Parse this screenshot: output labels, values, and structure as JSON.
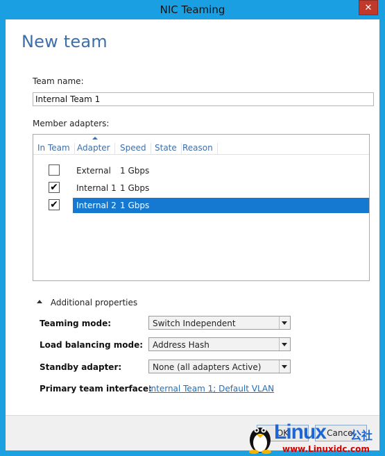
{
  "window": {
    "title": "NIC Teaming",
    "close_glyph": "✕"
  },
  "page": {
    "heading": "New team"
  },
  "team_name": {
    "label": "Team name:",
    "value": "Internal Team 1"
  },
  "member_adapters": {
    "label": "Member adapters:",
    "columns": [
      "In Team",
      "Adapter",
      "Speed",
      "State",
      "Reason"
    ],
    "sorted_column": "Adapter",
    "rows": [
      {
        "in_team": false,
        "adapter": "External",
        "speed": "1 Gbps",
        "state": "",
        "reason": "",
        "selected": false
      },
      {
        "in_team": true,
        "adapter": "Internal 1",
        "speed": "1 Gbps",
        "state": "",
        "reason": "",
        "selected": false
      },
      {
        "in_team": true,
        "adapter": "Internal 2",
        "speed": "1 Gbps",
        "state": "",
        "reason": "",
        "selected": true
      }
    ]
  },
  "additional": {
    "toggle_label": "Additional properties",
    "teaming_mode": {
      "label": "Teaming mode:",
      "value": "Switch Independent"
    },
    "load_balancing": {
      "label": "Load balancing mode:",
      "value": "Address Hash"
    },
    "standby": {
      "label": "Standby adapter:",
      "value": "None (all adapters Active)"
    },
    "primary_interface": {
      "label": "Primary team interface:",
      "link": "Internal Team 1; Default VLAN"
    }
  },
  "footer": {
    "ok_label": "OK",
    "cancel_label": "Cancel"
  },
  "watermark": {
    "brand": "Linux",
    "cn": "公社",
    "url": "www.Linuxidc.com"
  },
  "colors": {
    "titlebar": "#1aa0e2",
    "heading": "#3e6ea8",
    "selection": "#1579d1",
    "link": "#1c6fc0",
    "close": "#c0392b"
  }
}
